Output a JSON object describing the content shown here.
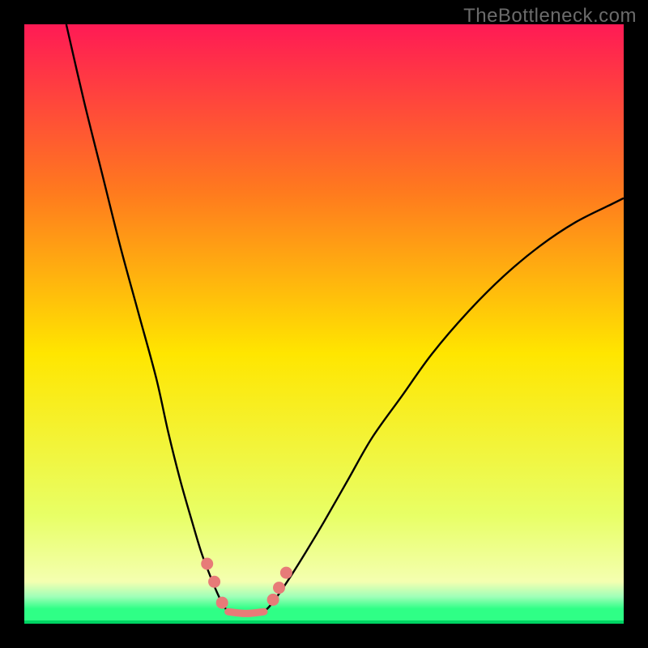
{
  "watermark": "TheBottleneck.com",
  "chart_data": {
    "type": "line",
    "title": "",
    "xlabel": "",
    "ylabel": "",
    "xlim": [
      0,
      100
    ],
    "ylim": [
      0,
      100
    ],
    "background_gradient": {
      "top": "#ff1a55",
      "upper_mid": "#ff7a1e",
      "mid": "#ffe600",
      "lower_mid": "#e8ff66",
      "green_band": "#2fff86",
      "bottom_line": "#00d463"
    },
    "series": [
      {
        "name": "left-curve",
        "x": [
          7,
          10,
          13,
          16,
          19,
          22,
          24,
          26,
          28,
          29.5,
          31,
          32.25,
          33.25,
          34
        ],
        "y": [
          100,
          87,
          75,
          63,
          52,
          41,
          32,
          24,
          17,
          12,
          8,
          5,
          3,
          2
        ]
      },
      {
        "name": "right-curve",
        "x": [
          40,
          41,
          42.5,
          44.5,
          47,
          50,
          54,
          58,
          63,
          68,
          74,
          80,
          86,
          92,
          98,
          100
        ],
        "y": [
          2,
          3,
          5,
          8,
          12,
          17,
          24,
          31,
          38,
          45,
          52,
          58,
          63,
          67,
          70,
          71
        ]
      }
    ],
    "valley_floor": {
      "x_start": 34,
      "x_end": 40,
      "y": 2
    },
    "markers_left": [
      {
        "x": 30.5,
        "y": 10
      },
      {
        "x": 31.7,
        "y": 7
      },
      {
        "x": 33.0,
        "y": 3.5
      }
    ],
    "markers_right": [
      {
        "x": 41.5,
        "y": 4
      },
      {
        "x": 42.5,
        "y": 6
      },
      {
        "x": 43.7,
        "y": 8.5
      }
    ],
    "valley_segment_color": "#e77b78",
    "curve_color": "#000000",
    "curve_width": 2.4
  }
}
